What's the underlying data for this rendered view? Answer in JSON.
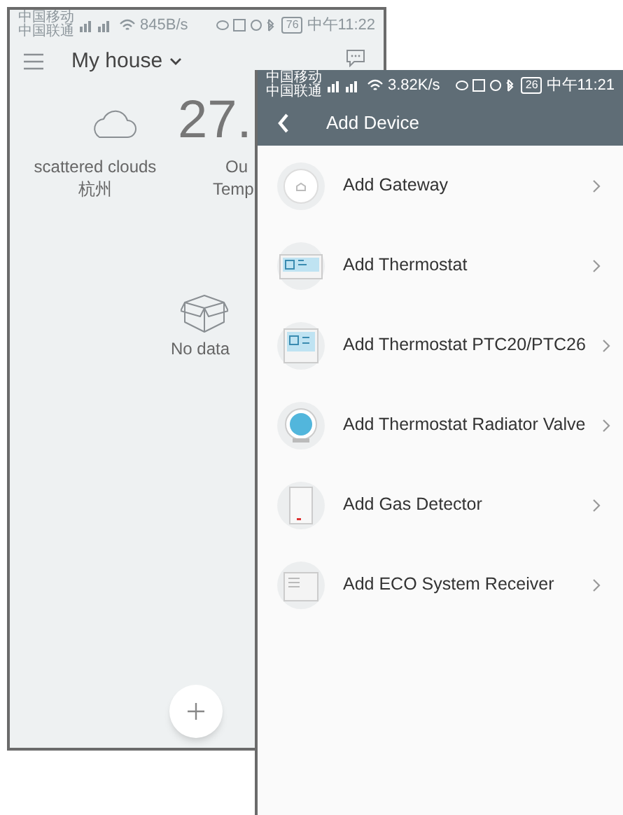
{
  "back_screen": {
    "status_bar": {
      "carriers": [
        "中国移动",
        "中国联通"
      ],
      "speed": "845B/s",
      "battery": "76",
      "time": "中午11:22"
    },
    "header": {
      "title": "My house"
    },
    "weather": {
      "condition": "scattered clouds",
      "city": "杭州",
      "temperature": "27.",
      "outdoor_label": [
        "Ou",
        "Temp"
      ]
    },
    "empty_state": {
      "text": "No data"
    }
  },
  "add_device_screen": {
    "status_bar": {
      "carriers": [
        "中国移动",
        "中国联通"
      ],
      "speed": "3.82K/s",
      "battery": "26",
      "time": "中午11:21"
    },
    "toolbar": {
      "title": "Add Device"
    },
    "devices": [
      {
        "kind": "gateway",
        "label": "Add Gateway"
      },
      {
        "kind": "thermostat",
        "label": "Add Thermostat"
      },
      {
        "kind": "thermostat2",
        "label": "Add Thermostat PTC20/PTC26"
      },
      {
        "kind": "valve",
        "label": "Add Thermostat Radiator Valve"
      },
      {
        "kind": "gas",
        "label": "Add Gas Detector"
      },
      {
        "kind": "receiver",
        "label": "Add ECO System Receiver"
      }
    ]
  }
}
